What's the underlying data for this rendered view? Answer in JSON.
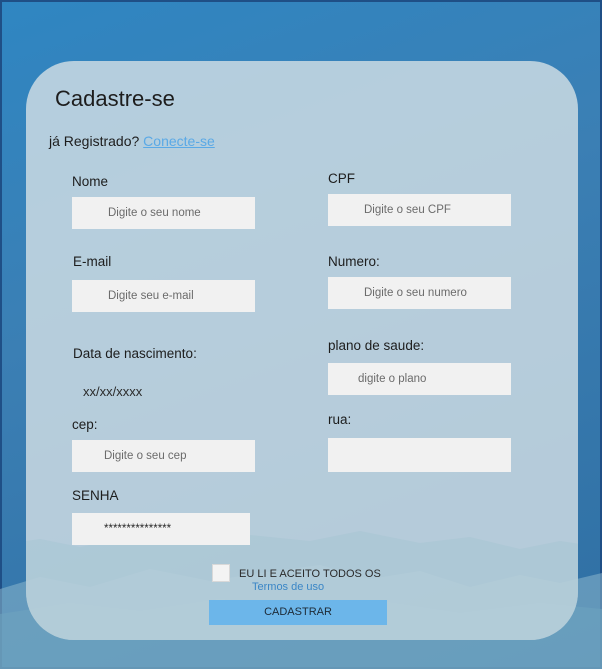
{
  "form": {
    "title": "Cadastre-se",
    "already_registered": "já  Registrado?",
    "login_link": "Conecte-se",
    "fields": {
      "nome": {
        "label": "Nome",
        "placeholder": "Digite o  seu nome"
      },
      "cpf": {
        "label": "CPF",
        "placeholder": "Digite o  seu CPF"
      },
      "email": {
        "label": "E-mail",
        "placeholder": "Digite  seu e-mail"
      },
      "numero": {
        "label": "Numero:",
        "placeholder": "Digite o  seu numero"
      },
      "nascimento": {
        "label": "Data de nascimento:",
        "value": "xx/xx/xxxx"
      },
      "plano": {
        "label": "plano de saude:",
        "placeholder": "digite o plano"
      },
      "cep": {
        "label": "cep:",
        "placeholder": "Digite o seu cep"
      },
      "rua": {
        "label": "rua:",
        "placeholder": ""
      },
      "senha": {
        "label": "SENHA",
        "value": "***************"
      }
    },
    "accept_text": "EU LI E ACEITO TODOS OS",
    "terms_link": "Termos de uso",
    "submit_label": "CADASTRAR"
  }
}
